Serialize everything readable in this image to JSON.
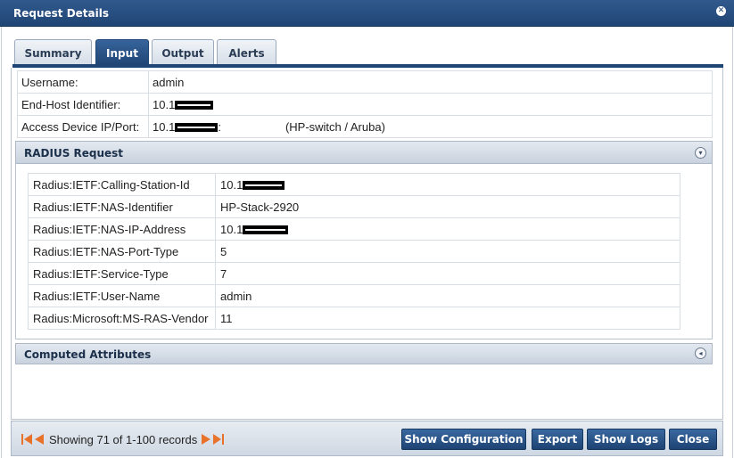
{
  "window": {
    "title": "Request Details",
    "close_glyph": "✕"
  },
  "tabs": [
    {
      "label": "Summary",
      "active": false
    },
    {
      "label": "Input",
      "active": true
    },
    {
      "label": "Output",
      "active": false
    },
    {
      "label": "Alerts",
      "active": false
    }
  ],
  "info": {
    "username_label": "Username:",
    "username_value": "admin",
    "endhost_label": "End-Host Identifier:",
    "endhost_prefix": "10.1",
    "access_label": "Access Device IP/Port:",
    "access_prefix": "10.1",
    "access_sep": ":",
    "access_device": "(HP-switch / Aruba)"
  },
  "radius": {
    "title": "RADIUS Request",
    "rows": [
      {
        "key": "Radius:IETF:Calling-Station-Id",
        "value": "10.1",
        "redacted": true
      },
      {
        "key": "Radius:IETF:NAS-Identifier",
        "value": "HP-Stack-2920",
        "redacted": false
      },
      {
        "key": "Radius:IETF:NAS-IP-Address",
        "value": "10.1",
        "redacted": true
      },
      {
        "key": "Radius:IETF:NAS-Port-Type",
        "value": "5",
        "redacted": false
      },
      {
        "key": "Radius:IETF:Service-Type",
        "value": "7",
        "redacted": false
      },
      {
        "key": "Radius:IETF:User-Name",
        "value": "admin",
        "redacted": false
      },
      {
        "key": "Radius:Microsoft:MS-RAS-Vendor",
        "value": "11",
        "redacted": false
      }
    ]
  },
  "computed": {
    "title": "Computed Attributes"
  },
  "footer": {
    "pager_text": "Showing 71 of 1-100 records",
    "buttons": {
      "show_configuration": "Show Configuration",
      "export": "Export",
      "show_logs": "Show Logs",
      "close": "Close"
    }
  },
  "colors": {
    "accent": "#1f4574",
    "pager_arrow": "#e8722a"
  },
  "icons": {
    "collapse": "chevron-up-icon",
    "expand": "chevron-left-icon"
  }
}
